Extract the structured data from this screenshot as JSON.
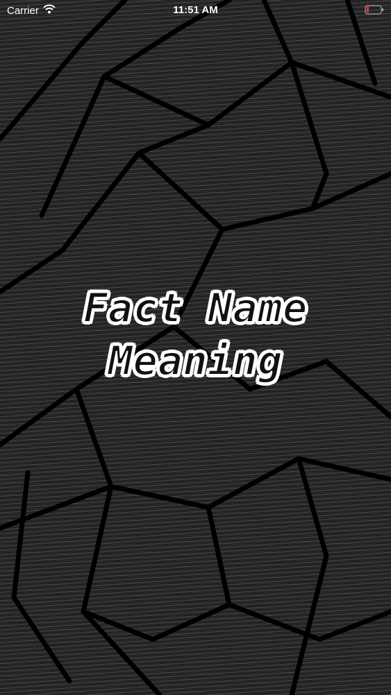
{
  "status_bar": {
    "carrier": "Carrier",
    "time": "11:51 AM"
  },
  "splash": {
    "title_line1": "Fact Name",
    "title_line2": "Meaning"
  },
  "colors": {
    "background": "#232323",
    "title_fill": "#111111",
    "title_outline": "#ffffff",
    "battery": "#ff3b30"
  },
  "icons": {
    "wifi": "wifi-icon",
    "battery": "battery-icon"
  }
}
